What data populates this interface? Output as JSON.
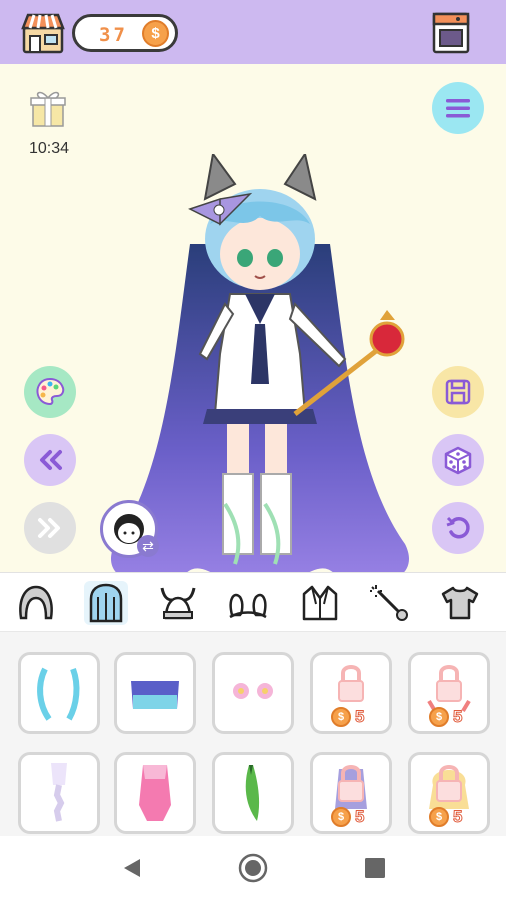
{
  "topbar": {
    "coins": "37",
    "coin_symbol": "$"
  },
  "stage": {
    "timer": "10:34"
  },
  "tabs": [
    {
      "name": "hair-front"
    },
    {
      "name": "hair-back"
    },
    {
      "name": "headwear"
    },
    {
      "name": "ears"
    },
    {
      "name": "outfit-jacket"
    },
    {
      "name": "accessories-wand"
    },
    {
      "name": "tops"
    }
  ],
  "items": [
    {
      "id": "item-1",
      "locked": false
    },
    {
      "id": "item-2",
      "locked": false
    },
    {
      "id": "item-3",
      "locked": false
    },
    {
      "id": "item-4",
      "locked": true,
      "price": "5"
    },
    {
      "id": "item-5",
      "locked": true,
      "price": "5"
    },
    {
      "id": "item-6",
      "locked": false
    },
    {
      "id": "item-7",
      "locked": false
    },
    {
      "id": "item-8",
      "locked": false
    },
    {
      "id": "item-9",
      "locked": true,
      "price": "5"
    },
    {
      "id": "item-10",
      "locked": true,
      "price": "5"
    }
  ],
  "colors": {
    "topbar": "#cdb9f0",
    "stage_bg": "#fdfbe8",
    "button_purple": "#d9c6f5",
    "coin": "#f6a14b"
  }
}
